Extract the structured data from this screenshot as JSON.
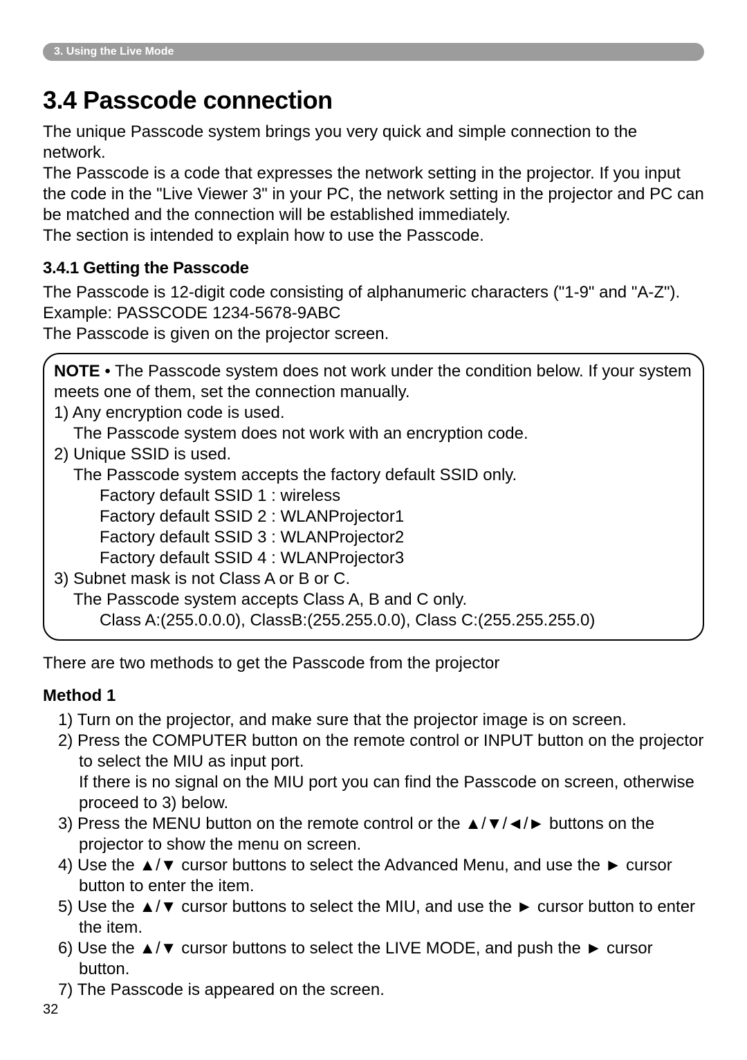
{
  "chapter_bar": "3. Using the Live Mode",
  "section_title": "3.4 Passcode connection",
  "intro_p1": "The unique Passcode system brings you very quick and simple connection to the network.",
  "intro_p2": "The Passcode is a code that expresses the network setting in the projector. If you input the code in the \"Live Viewer 3\" in your PC, the network setting in the projector and PC can be matched and the connection will be established immediately.",
  "intro_p3": "The section is intended to explain how to use the Passcode.",
  "subsection_title": "3.4.1 Getting the Passcode",
  "sub_p1": "The Passcode is 12-digit code consisting of alphanumeric characters (\"1-9\" and \"A-Z\"). Example: PASSCODE 1234-5678-9ABC",
  "sub_p2": "The Passcode is given on the projector screen.",
  "note": {
    "label": "NOTE",
    "lead": " • The Passcode system does not work under the condition below. If your system meets one of them, set the connection manually.",
    "line1": "1) Any encryption code is used.",
    "line1a": "The Passcode system does not work with an encryption code.",
    "line2": "2) Unique SSID is used.",
    "line2a": "The Passcode system accepts the factory default SSID only.",
    "ssid1": "Factory default SSID 1 : wireless",
    "ssid2": "Factory default SSID 2 : WLANProjector1",
    "ssid3": "Factory default SSID 3 : WLANProjector2",
    "ssid4": "Factory default SSID 4 : WLANProjector3",
    "line3": "3) Subnet mask is not Class A or B or C.",
    "line3a": "The Passcode system accepts Class A, B and C only.",
    "line3b": "Class A:(255.0.0.0), ClassB:(255.255.0.0), Class C:(255.255.255.0)"
  },
  "post_note": "There are two methods to get the Passcode from the projector",
  "method_heading": "Method 1",
  "m1": "1) Turn on the projector, and make sure that the projector image is on screen.",
  "m2": "2) Press the COMPUTER button on the remote control or INPUT button on the projector to select the MIU as input port.\nIf there is no signal on the MIU port you can find the Passcode on screen, otherwise proceed to 3) below.",
  "m3": "3) Press the MENU button on the remote control or the ▲/▼/◄/► buttons on the projector to show the menu on screen.",
  "m4": "4) Use the ▲/▼ cursor buttons to select the Advanced Menu, and use the ► cursor button to enter the item.",
  "m5": "5) Use the ▲/▼ cursor buttons to select the MIU, and use the ► cursor button to enter the item.",
  "m6": "6) Use the ▲/▼ cursor buttons to select the LIVE MODE, and push the ► cursor button.",
  "m7": "7) The Passcode is appeared on the screen.",
  "page_number": "32"
}
